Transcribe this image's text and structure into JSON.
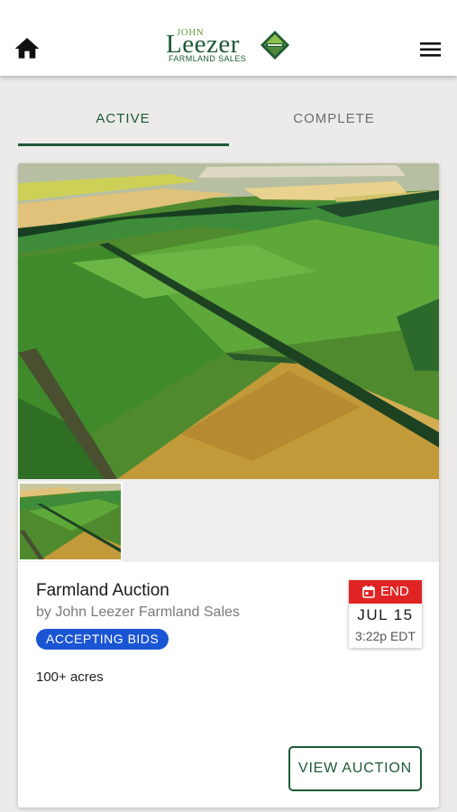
{
  "header": {
    "logo": {
      "top": "JOHN",
      "name": "Leezer",
      "sub": "FARMLAND SALES"
    },
    "home_icon": "home-icon",
    "menu_icon": "hamburger-menu-icon"
  },
  "tabs": [
    {
      "label": "ACTIVE",
      "selected": true
    },
    {
      "label": "COMPLETE",
      "selected": false
    }
  ],
  "listing": {
    "title": "Farmland Auction",
    "byline": "by John Leezer Farmland Sales",
    "status": "ACCEPTING BIDS",
    "details": "100+ acres",
    "end": {
      "label": "END",
      "date": "JUL 15",
      "time": "3:22p EDT"
    },
    "action_label": "VIEW AUCTION"
  },
  "colors": {
    "brand_green": "#1e5a36",
    "status_blue": "#1a55d4",
    "end_red": "#e02424",
    "page_bg": "#ecebe9"
  }
}
